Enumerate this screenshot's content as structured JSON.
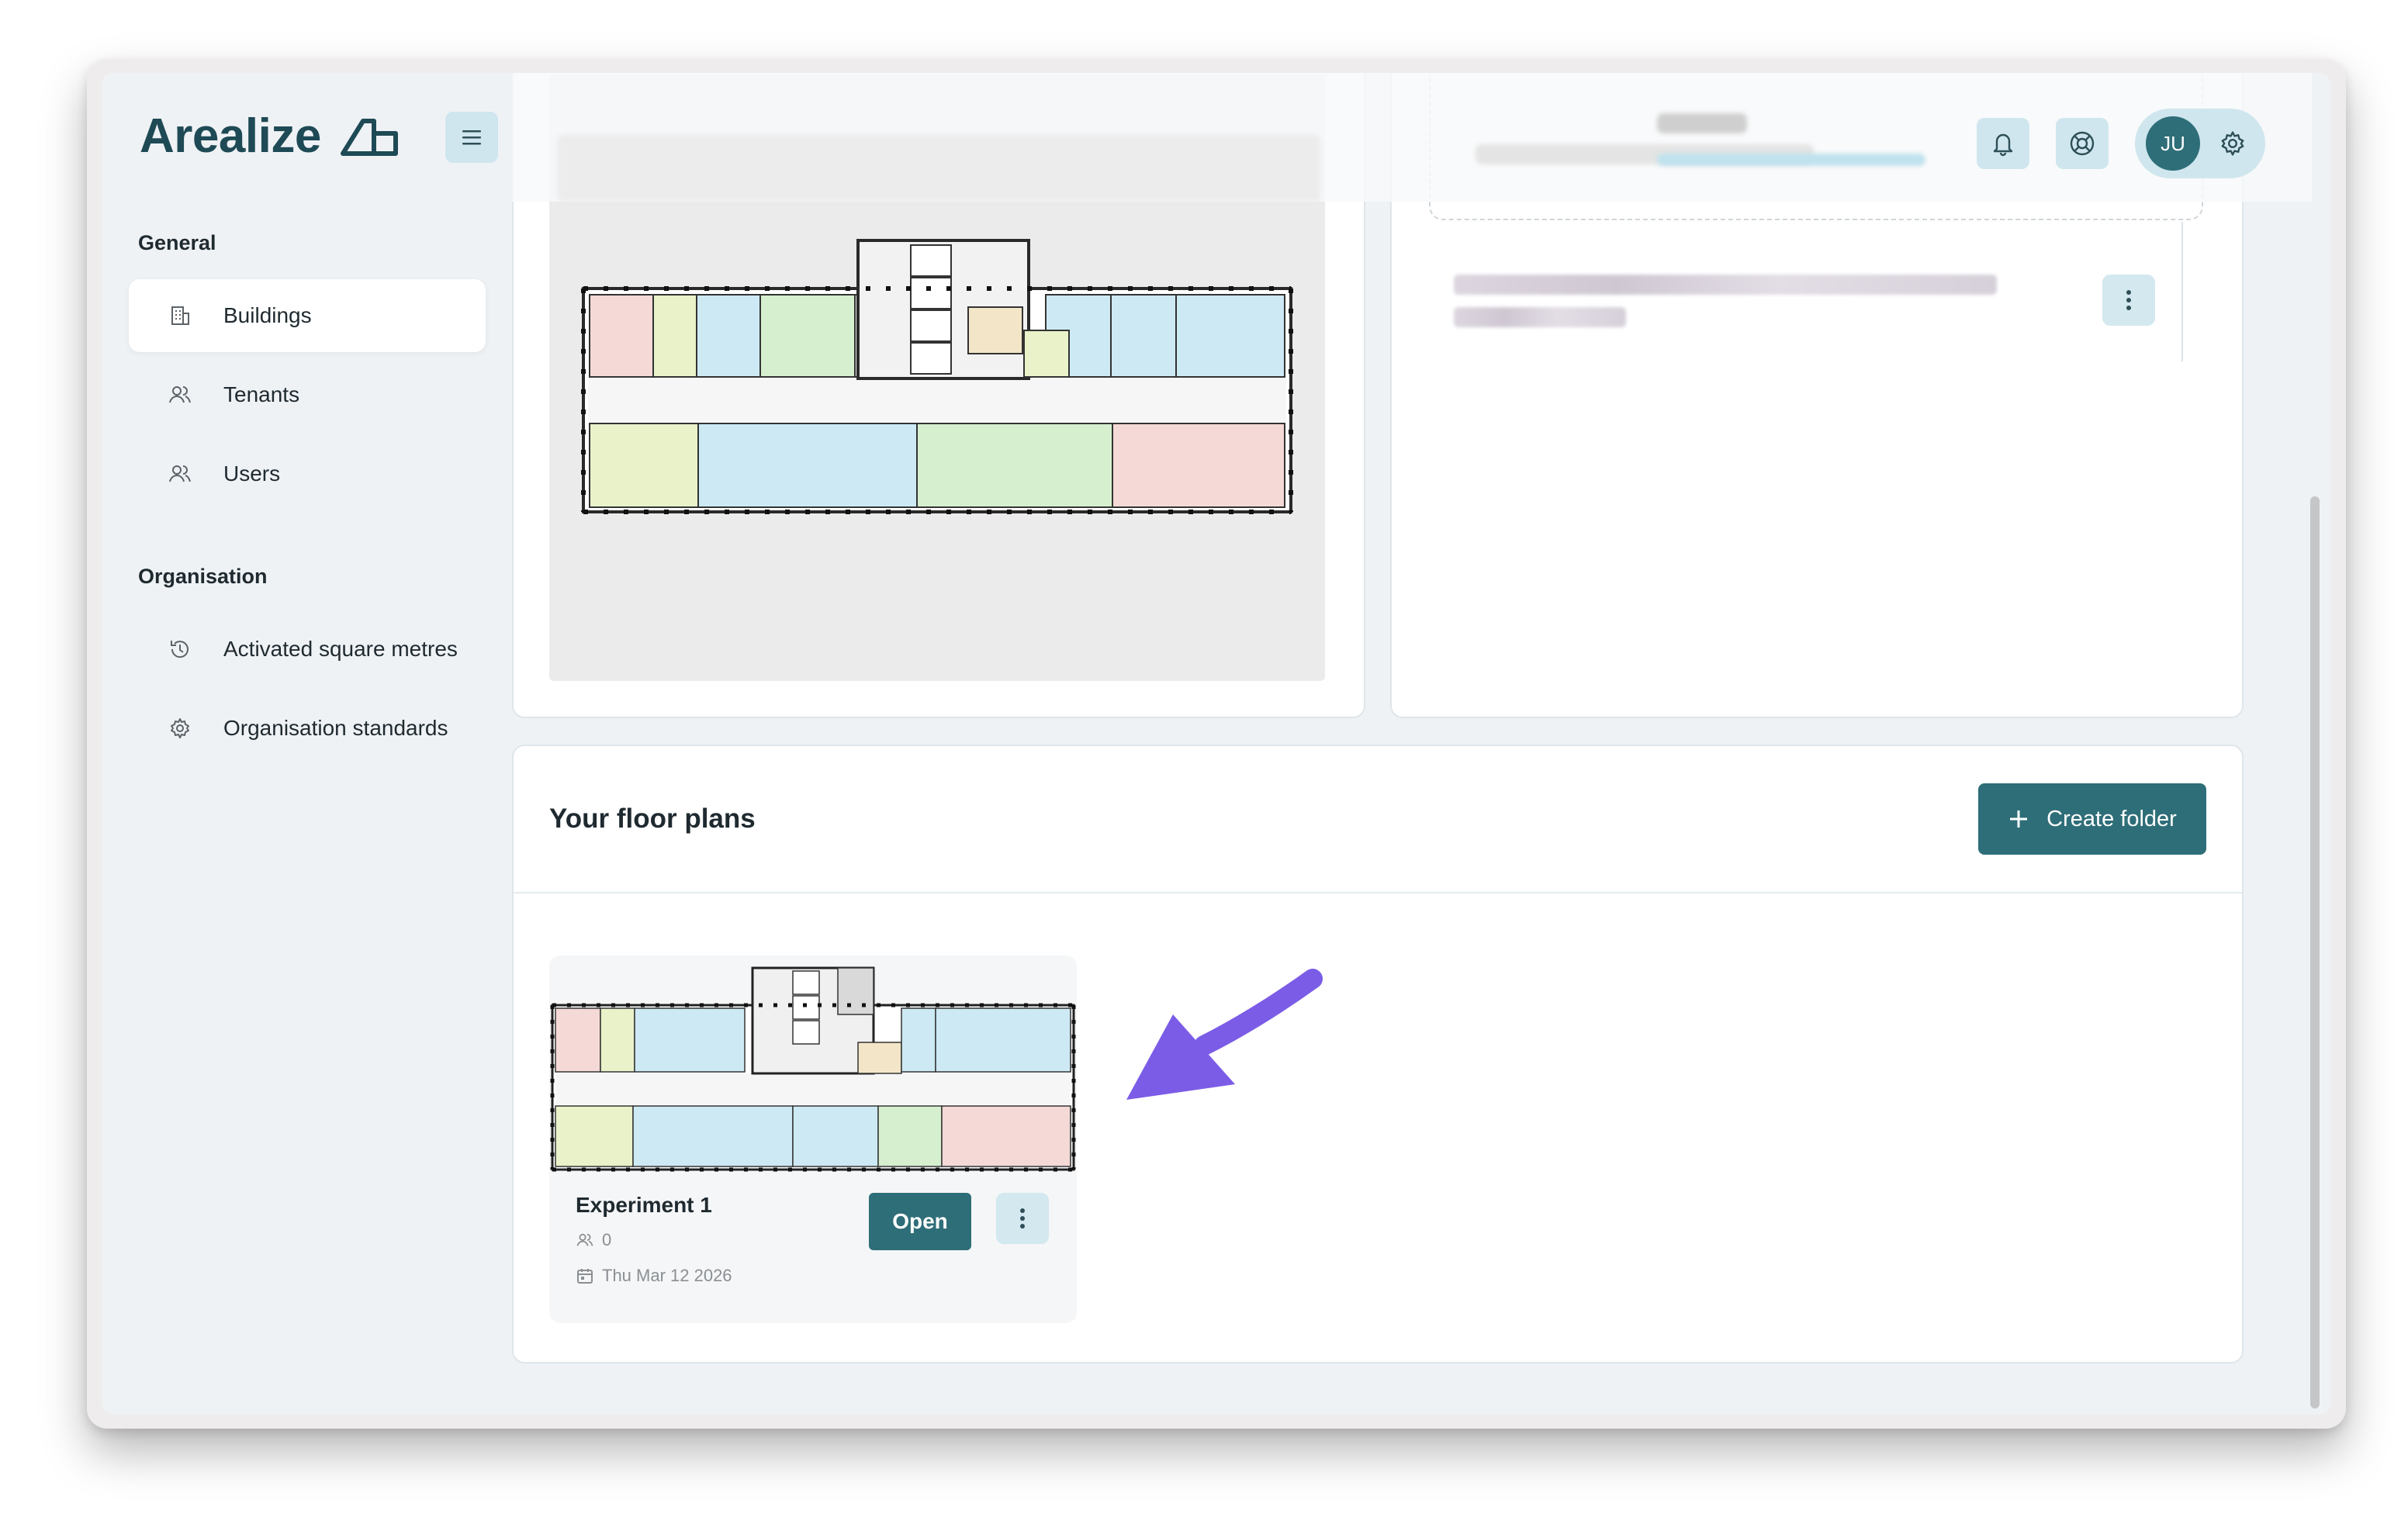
{
  "app": {
    "logo_text": "Arealize"
  },
  "sidebar": {
    "sections": [
      {
        "label": "General"
      },
      {
        "label": "Organisation"
      }
    ],
    "items": [
      {
        "label": "Buildings",
        "icon": "building-icon",
        "active": true
      },
      {
        "label": "Tenants",
        "icon": "users-icon"
      },
      {
        "label": "Users",
        "icon": "users-icon"
      },
      {
        "label": "Activated square metres",
        "icon": "history-icon"
      },
      {
        "label": "Organisation standards",
        "icon": "gear-icon"
      }
    ]
  },
  "header": {
    "user_initials": "JU",
    "icons": [
      "bell-icon",
      "lifebuoy-icon",
      "gear-icon"
    ]
  },
  "floor_plans": {
    "title": "Your floor plans",
    "create_label": "Create folder",
    "items": [
      {
        "name": "Experiment 1",
        "members": "0",
        "date": "Thu Mar 12 2026",
        "open_label": "Open"
      }
    ]
  },
  "colors": {
    "accent": "#2e6e78",
    "accent_light": "#cfe6ee",
    "arrow": "#7b5ce6",
    "room_pink": "#f4d9d6",
    "room_yellow": "#e9f2c9",
    "room_blue": "#cdeaf4",
    "room_green": "#d6efcf"
  }
}
